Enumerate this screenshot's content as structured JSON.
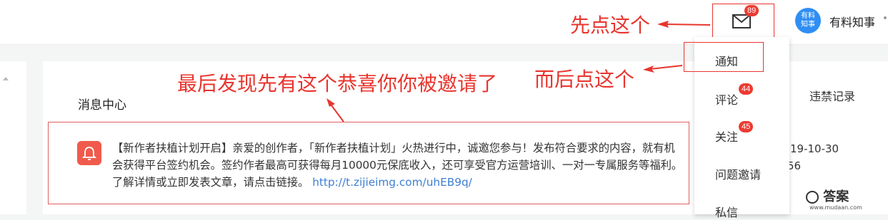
{
  "header": {
    "mail_badge": "89",
    "avatar_line1": "有料",
    "avatar_line2": "知事",
    "username": "有料知事"
  },
  "annotations": {
    "first_click": "先点这个",
    "then_click": "而后点这个",
    "finally_found": "最后发现先有这个恭喜你你被邀请了"
  },
  "dropdown": {
    "items": [
      {
        "label": "通知",
        "badge": ""
      },
      {
        "label": "评论",
        "badge": "44"
      },
      {
        "label": "关注",
        "badge": "45"
      },
      {
        "label": "问题邀请",
        "badge": ""
      },
      {
        "label": "私信",
        "badge": ""
      }
    ]
  },
  "main": {
    "title": "消息中心",
    "violation_tab": "违禁记录",
    "date": "19-10-30",
    "date_partial": "56",
    "notice_text": "【新作者扶植计划开启】亲爱的创作者，「新作者扶植计划」火热进行中，诚邀您参与！发布符合要求的内容，就有机会获得平台签约机会。签约作者最高可获得每月10000元保底收入，还可享受官方运营培训、一对一专属服务等福利。了解详情或立即发表文章，请点击链接。",
    "notice_link": "http://t.zijieimg.com/uhEB9q/"
  },
  "watermark": {
    "brand": "答案",
    "url": "www.mudaan.com"
  },
  "colors": {
    "annotation_red": "#e8352e",
    "badge_red": "#ec3b32",
    "avatar_blue": "#2f8ef3",
    "link_blue": "#3f7fd5"
  }
}
